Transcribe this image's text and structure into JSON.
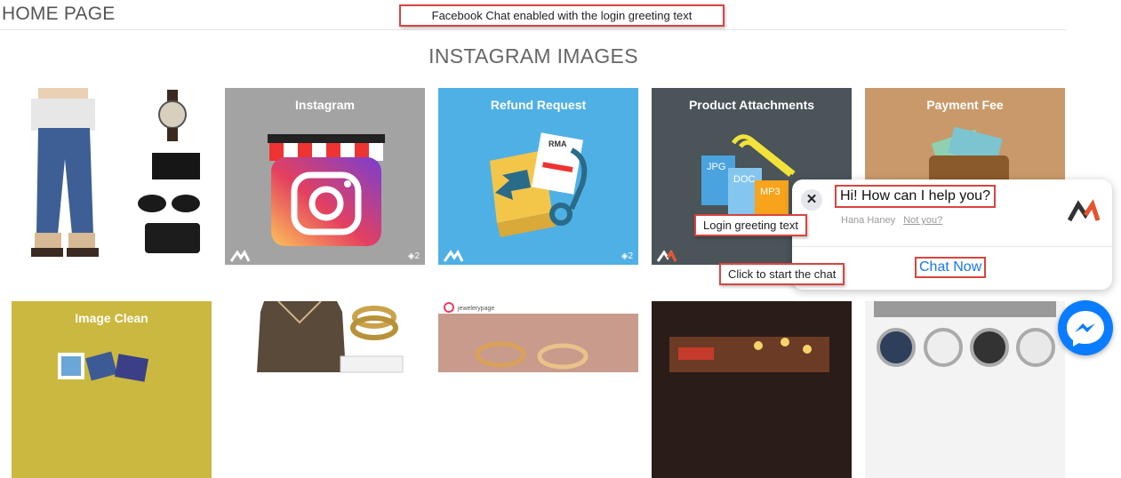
{
  "header": {
    "title": "HOME PAGE"
  },
  "section": {
    "title": "INSTAGRAM IMAGES"
  },
  "annotations": {
    "top": "Facebook Chat enabled with the login greeting text",
    "greeting": "Login greeting text",
    "chat": "Click to start the chat"
  },
  "tiles": [
    {
      "label": "",
      "image": "clothing-accessories"
    },
    {
      "label": "Instagram",
      "image": "instagram-store",
      "badge": "2"
    },
    {
      "label": "Refund Request",
      "image": "refund-box",
      "badge": "2",
      "rma": "RMA"
    },
    {
      "label": "Product Attachments",
      "image": "file-attachments",
      "files": [
        "JPG",
        "DOC",
        "MP3"
      ]
    },
    {
      "label": "Payment Fee",
      "image": "wallet"
    },
    {
      "label": "Image Clean",
      "image": "photo-icons"
    },
    {
      "label": "",
      "image": "sweater-bangles"
    },
    {
      "label": "",
      "image": "jewelry-rings",
      "handle": "jewelerypage"
    },
    {
      "label": "",
      "image": "birthday-cake"
    },
    {
      "label": "",
      "image": "wristwatches"
    }
  ],
  "chat": {
    "greeting": "Hi! How can I help you?",
    "agent_name": "Hana Haney",
    "not_you": "Not you?",
    "cta": "Chat Now",
    "close_icon": "close-icon",
    "messenger_icon": "messenger-icon"
  },
  "colors": {
    "annotation_border": "#d9443f",
    "messenger_blue": "#0a7cff",
    "link_blue": "#1877f2",
    "tile_instagram": "#a3a3a3",
    "tile_refund": "#4fb0e6",
    "tile_attachments": "#4a5459",
    "tile_payment": "#c9996a",
    "tile_imageclean": "#cbb840"
  }
}
